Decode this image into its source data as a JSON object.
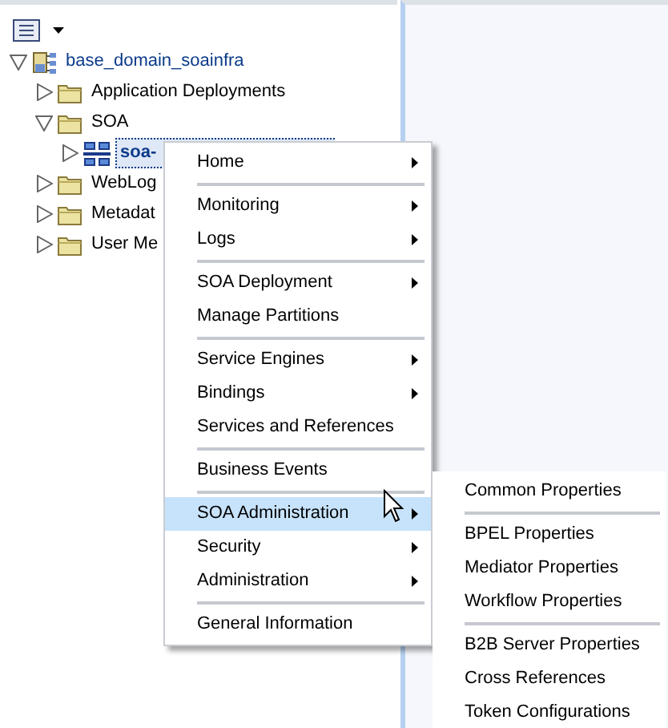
{
  "tree": [
    {
      "label": "base_domain_soainfra",
      "kind": "domain",
      "expanded": true,
      "selected": false,
      "children": [
        {
          "label": "Application Deployments",
          "kind": "folder",
          "expanded": false,
          "selected": false
        },
        {
          "label": "SOA",
          "kind": "folder",
          "expanded": true,
          "selected": false,
          "children": [
            {
              "label": "soa-",
              "kind": "server",
              "expanded": false,
              "selected": true
            }
          ]
        },
        {
          "label": "WebLog",
          "kind": "folder",
          "expanded": false,
          "selected": false
        },
        {
          "label": "Metadat",
          "kind": "folder",
          "expanded": false,
          "selected": false
        },
        {
          "label": "User Me",
          "kind": "folder",
          "expanded": false,
          "selected": false
        }
      ]
    }
  ],
  "context_menu": {
    "groups": [
      [
        {
          "label": "Home",
          "has_submenu": true,
          "selected": false
        }
      ],
      [
        {
          "label": "Monitoring",
          "has_submenu": true,
          "selected": false
        },
        {
          "label": "Logs",
          "has_submenu": true,
          "selected": false
        }
      ],
      [
        {
          "label": "SOA Deployment",
          "has_submenu": true,
          "selected": false
        },
        {
          "label": "Manage Partitions",
          "has_submenu": false,
          "selected": false
        }
      ],
      [
        {
          "label": "Service Engines",
          "has_submenu": true,
          "selected": false
        },
        {
          "label": "Bindings",
          "has_submenu": true,
          "selected": false
        },
        {
          "label": "Services and References",
          "has_submenu": false,
          "selected": false
        }
      ],
      [
        {
          "label": "Business Events",
          "has_submenu": false,
          "selected": false
        }
      ],
      [
        {
          "label": "SOA Administration",
          "has_submenu": true,
          "selected": true
        },
        {
          "label": "Security",
          "has_submenu": true,
          "selected": false
        },
        {
          "label": "Administration",
          "has_submenu": true,
          "selected": false
        }
      ],
      [
        {
          "label": "General Information",
          "has_submenu": false,
          "selected": false
        }
      ]
    ]
  },
  "submenu": {
    "groups": [
      [
        {
          "label": "Common Properties"
        }
      ],
      [
        {
          "label": "BPEL Properties"
        },
        {
          "label": "Mediator Properties"
        },
        {
          "label": "Workflow Properties"
        }
      ],
      [
        {
          "label": "B2B Server Properties"
        },
        {
          "label": "Cross References"
        },
        {
          "label": "Token Configurations"
        }
      ]
    ]
  }
}
